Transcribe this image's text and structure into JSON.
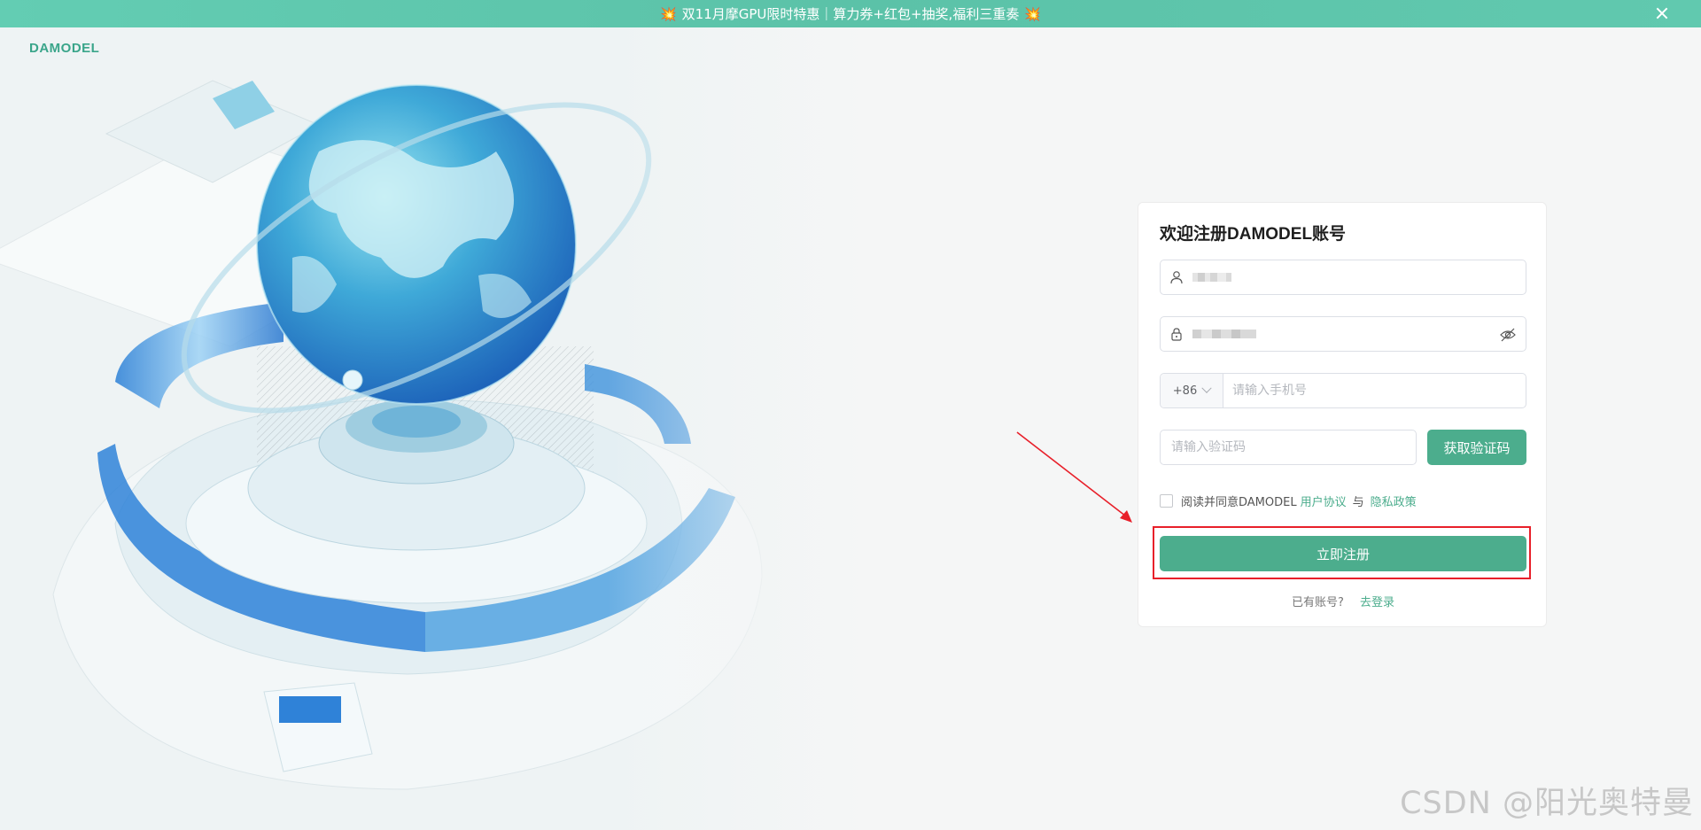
{
  "banner": {
    "text": "双11月摩GPU限时特惠｜算力券+红包+抽奖,福利三重奏",
    "fire_icon": "💥"
  },
  "logo": {
    "text": "DAMODEL"
  },
  "form": {
    "title": "欢迎注册DAMODEL账号",
    "phone_country_code": "+86",
    "phone_placeholder": "请输入手机号",
    "code_placeholder": "请输入验证码",
    "get_code_label": "获取验证码",
    "agree_prefix": "阅读并同意DAMODEL",
    "user_agreement": "用户协议",
    "and": "与",
    "privacy_policy": "隐私政策",
    "register_label": "立即注册",
    "have_account": "已有账号?",
    "go_login": "去登录"
  },
  "watermark": "CSDN @阳光奥特曼",
  "colors": {
    "brand": "#4cad8d",
    "banner": "#5bc2a8",
    "highlight_box": "#e8202a",
    "arrow": "#e8202a"
  }
}
